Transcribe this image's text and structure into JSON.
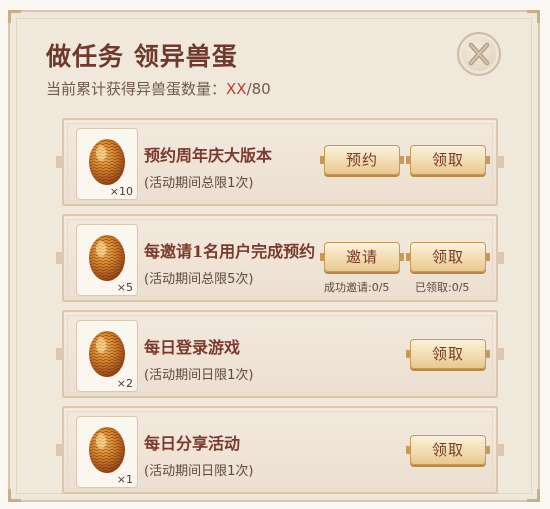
{
  "header": {
    "title": "做任务 领异兽蛋",
    "progress_label": "当前累计获得异兽蛋数量：",
    "progress_current": "XX",
    "progress_total": "/80",
    "accent_color": "#c23b2a"
  },
  "close_button": {
    "icon": "close-x-icon"
  },
  "tasks": [
    {
      "name": "预约周年庆大版本",
      "limit": "(活动期间总限1次)",
      "reward_icon": "golden-egg-icon",
      "reward_count": "×10",
      "buttons": {
        "primary": "预约",
        "claim": "领取"
      }
    },
    {
      "name": "每邀请1名用户完成预约",
      "limit": "(活动期间总限5次)",
      "reward_icon": "golden-egg-icon",
      "reward_count": "×5",
      "buttons": {
        "primary": "邀请",
        "claim": "领取"
      },
      "stats": {
        "invited": "成功邀请:0/5",
        "claimed": "已领取:0/5"
      }
    },
    {
      "name": "每日登录游戏",
      "limit": "(活动期间日限1次)",
      "reward_icon": "golden-egg-icon",
      "reward_count": "×2",
      "buttons": {
        "claim": "领取"
      }
    },
    {
      "name": "每日分享活动",
      "limit": "(活动期间日限1次)",
      "reward_icon": "golden-egg-icon",
      "reward_count": "×1",
      "buttons": {
        "claim": "领取"
      }
    }
  ]
}
